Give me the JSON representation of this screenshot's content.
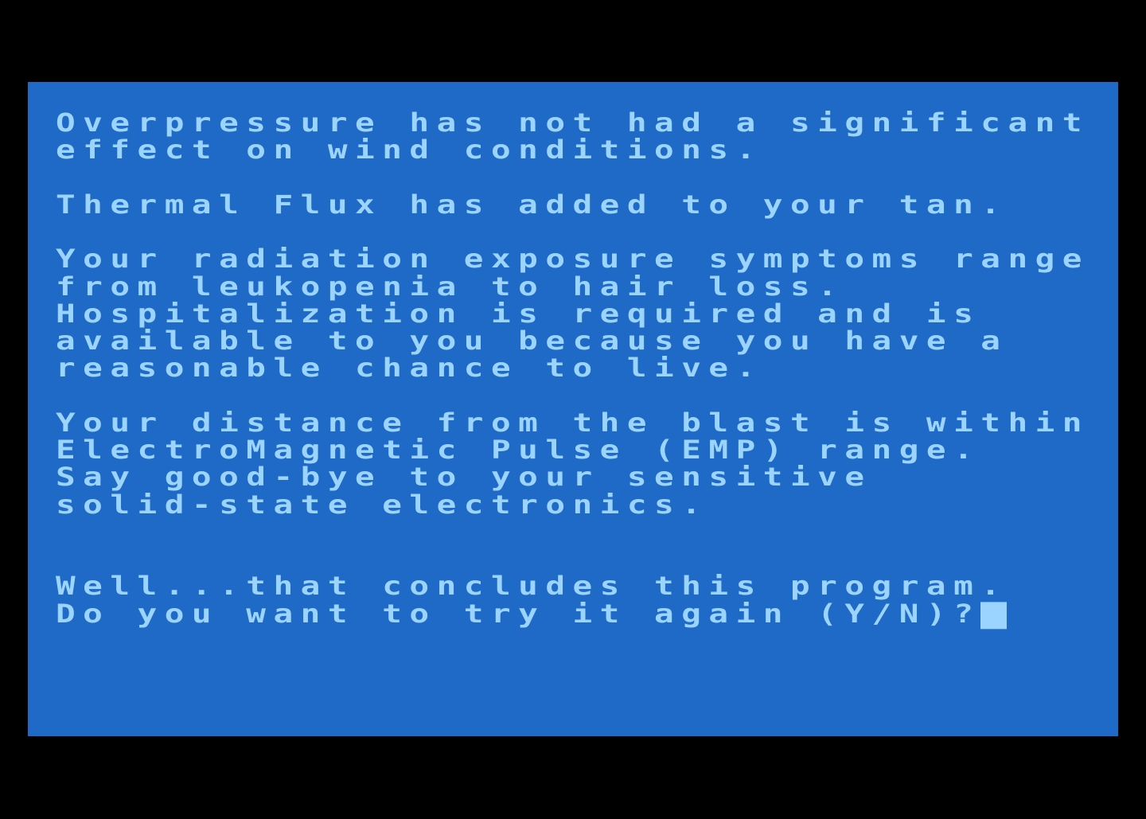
{
  "screen": {
    "background_color": "#1e6ac6",
    "text_color": "#9bd4ff",
    "border_color": "#000000",
    "lines": [
      "Overpressure has not had a significant",
      "effect on wind conditions.",
      "",
      "Thermal Flux has added to your tan.",
      "",
      "Your radiation exposure symptoms range",
      "from leukopenia to hair loss.",
      "Hospitalization is required and is",
      "available to you because you have a",
      "reasonable chance to live.",
      "",
      "Your distance from the blast is within",
      "ElectroMagnetic Pulse (EMP) range.",
      "Say good-bye to your sensitive",
      "solid-state electronics.",
      "",
      "",
      "Well...that concludes this program.",
      "Do you want to try it again (Y/N)?"
    ],
    "cursor": "block-cursor"
  }
}
